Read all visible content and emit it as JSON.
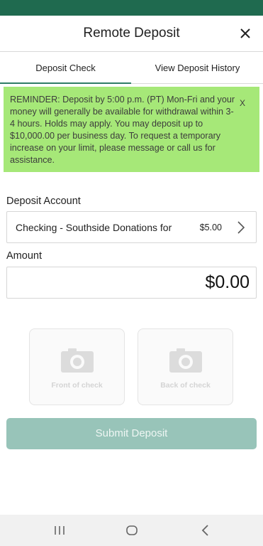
{
  "header": {
    "title": "Remote Deposit",
    "close_icon": "close-icon"
  },
  "tabs": [
    {
      "label": "Deposit Check",
      "active": true
    },
    {
      "label": "View Deposit History",
      "active": false
    }
  ],
  "reminder": {
    "text": "REMINDER: Deposit by 5:00 p.m. (PT) Mon-Fri and your money will generally be available for withdrawal within 3-4 hours. Holds may apply. You may deposit up to $10,000.00 per business day. To request a temporary increase on your limit, please message or call us for assistance.",
    "dismiss": "X",
    "background": "#a6e878"
  },
  "deposit_account": {
    "label": "Deposit Account",
    "account_name": "Checking - Southside Donations for",
    "balance": "$5.00"
  },
  "amount": {
    "label": "Amount",
    "value": "$0.00"
  },
  "check_images": {
    "front_label": "Front of check",
    "back_label": "Back of check",
    "icon": "camera-icon"
  },
  "submit": {
    "label": "Submit Deposit",
    "color": "#98c4b9"
  },
  "colors": {
    "brand": "#1f6a4f",
    "tab_indicator": "#2e7d66"
  },
  "system_nav": {
    "icons": [
      "recent-apps-icon",
      "home-icon",
      "back-icon"
    ]
  }
}
